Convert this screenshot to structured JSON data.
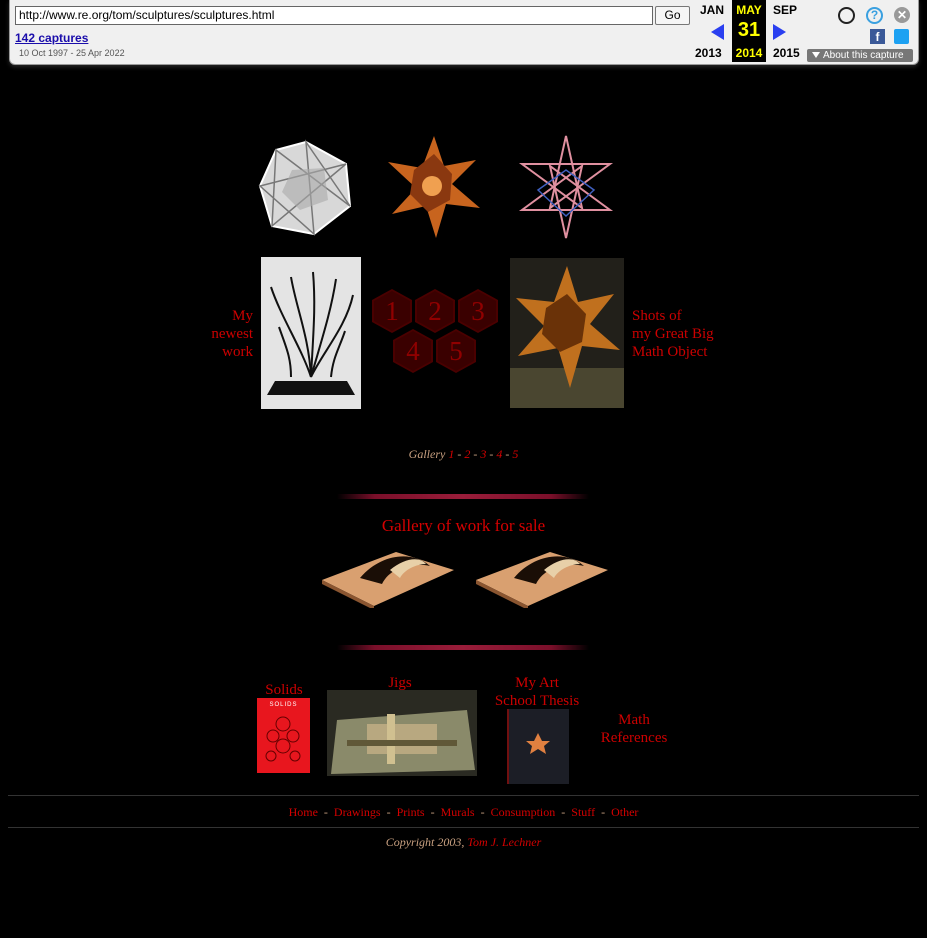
{
  "wayback": {
    "url": "http://www.re.org/tom/sculptures/sculptures.html",
    "go_label": "Go",
    "captures": "142 captures",
    "date_range": "10 Oct 1997 - 25 Apr 2022",
    "prev_month": "JAN",
    "prev_year": "2013",
    "cur_month": "MAY",
    "cur_day": "31",
    "cur_year": "2014",
    "next_month": "SEP",
    "next_year": "2015",
    "about_label": "About this capture"
  },
  "labels": {
    "newest_1": "My",
    "newest_2": "newest",
    "newest_3": "work",
    "gbmo_1": "Shots of",
    "gbmo_2": "my Great Big",
    "gbmo_3": "Math Object"
  },
  "hexes": [
    "1",
    "2",
    "3",
    "4",
    "5"
  ],
  "gallery": {
    "label": "Gallery",
    "pages": [
      "1",
      "2",
      "3",
      "4",
      "5"
    ]
  },
  "sale": {
    "title": "Gallery of work for sale"
  },
  "bottom": {
    "solids": "Solids",
    "solids_cover": "SOLIDS",
    "jigs": "Jigs",
    "thesis_1": "My Art",
    "thesis_2": "School Thesis",
    "math_1": "Math",
    "math_2": "References"
  },
  "footer": {
    "nav": [
      "Home",
      "Drawings",
      "Prints",
      "Murals",
      "Consumption",
      "Stuff",
      "Other"
    ],
    "copyright_prefix": "Copyright 2003,",
    "author": "Tom J. Lechner"
  },
  "colors": {
    "link": "#d40000",
    "accent_text": "#c8a080",
    "background": "#000000",
    "wayback_highlight": "#ffff00"
  }
}
